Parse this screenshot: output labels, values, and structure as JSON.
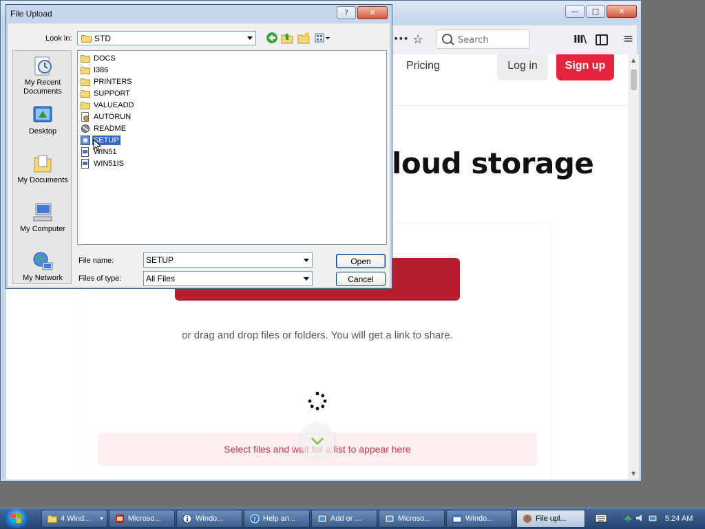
{
  "browser": {
    "toolbar": {
      "overflow_dots": "•••",
      "search_placeholder": "Search",
      "library_glyph": "III\\",
      "menu_glyph": "≡"
    },
    "window_controls": {
      "minimize": "—",
      "maximize": "□",
      "close": "✕"
    }
  },
  "site": {
    "nav": {
      "pricing": "Pricing",
      "login": "Log in",
      "signup": "Sign up"
    },
    "hero_title": "loud storage",
    "drag_drop_text": "or drag and drop files or folders. You will get a link to share.",
    "list_placeholder": "Select files and wait for a list to appear here",
    "colors": {
      "accent": "#e8243c",
      "upload_button": "#b51e2f",
      "list_bg": "#fdeef0",
      "list_text": "#d6344a"
    }
  },
  "dialog": {
    "title": "File Upload",
    "help_button": "?",
    "close_button": "✕",
    "look_in_label": "Look in:",
    "look_in_value": "STD",
    "places": [
      {
        "label": "My Recent Documents",
        "icon": "recent-documents-icon"
      },
      {
        "label": "Desktop",
        "icon": "desktop-icon"
      },
      {
        "label": "My Documents",
        "icon": "my-documents-icon"
      },
      {
        "label": "My Computer",
        "icon": "my-computer-icon"
      },
      {
        "label": "My Network",
        "icon": "my-network-icon"
      }
    ],
    "files": [
      {
        "name": "DOCS",
        "icon": "folder-icon"
      },
      {
        "name": "I386",
        "icon": "folder-icon"
      },
      {
        "name": "PRINTERS",
        "icon": "folder-icon"
      },
      {
        "name": "SUPPORT",
        "icon": "folder-icon"
      },
      {
        "name": "VALUEADD",
        "icon": "folder-icon"
      },
      {
        "name": "AUTORUN",
        "icon": "autorun-icon"
      },
      {
        "name": "README",
        "icon": "readme-icon"
      },
      {
        "name": "SETUP",
        "icon": "setup-icon",
        "selected": true
      },
      {
        "name": "WIN51",
        "icon": "system-file-icon"
      },
      {
        "name": "WIN51IS",
        "icon": "system-file-icon"
      }
    ],
    "file_name_label": "File name:",
    "file_name_value": "SETUP",
    "file_type_label": "Files of type:",
    "file_type_value": "All Files",
    "open_button": "Open",
    "cancel_button": "Cancel"
  },
  "taskbar": {
    "items": [
      {
        "label": "4 Wind...",
        "icon": "folder-icon",
        "has_arrow": true
      },
      {
        "label": "Microso...",
        "icon": "microsoft-icon"
      },
      {
        "label": "Windo...",
        "icon": "info-icon"
      },
      {
        "label": "Help an...",
        "icon": "help-icon"
      },
      {
        "label": "Add or ...",
        "icon": "add-remove-icon"
      },
      {
        "label": "Microso...",
        "icon": "microsoft-icon"
      },
      {
        "label": "Windo...",
        "icon": "window-icon"
      },
      {
        "label": "File upl...",
        "icon": "firefox-icon",
        "active": true
      }
    ],
    "clock": "5:24 AM"
  }
}
